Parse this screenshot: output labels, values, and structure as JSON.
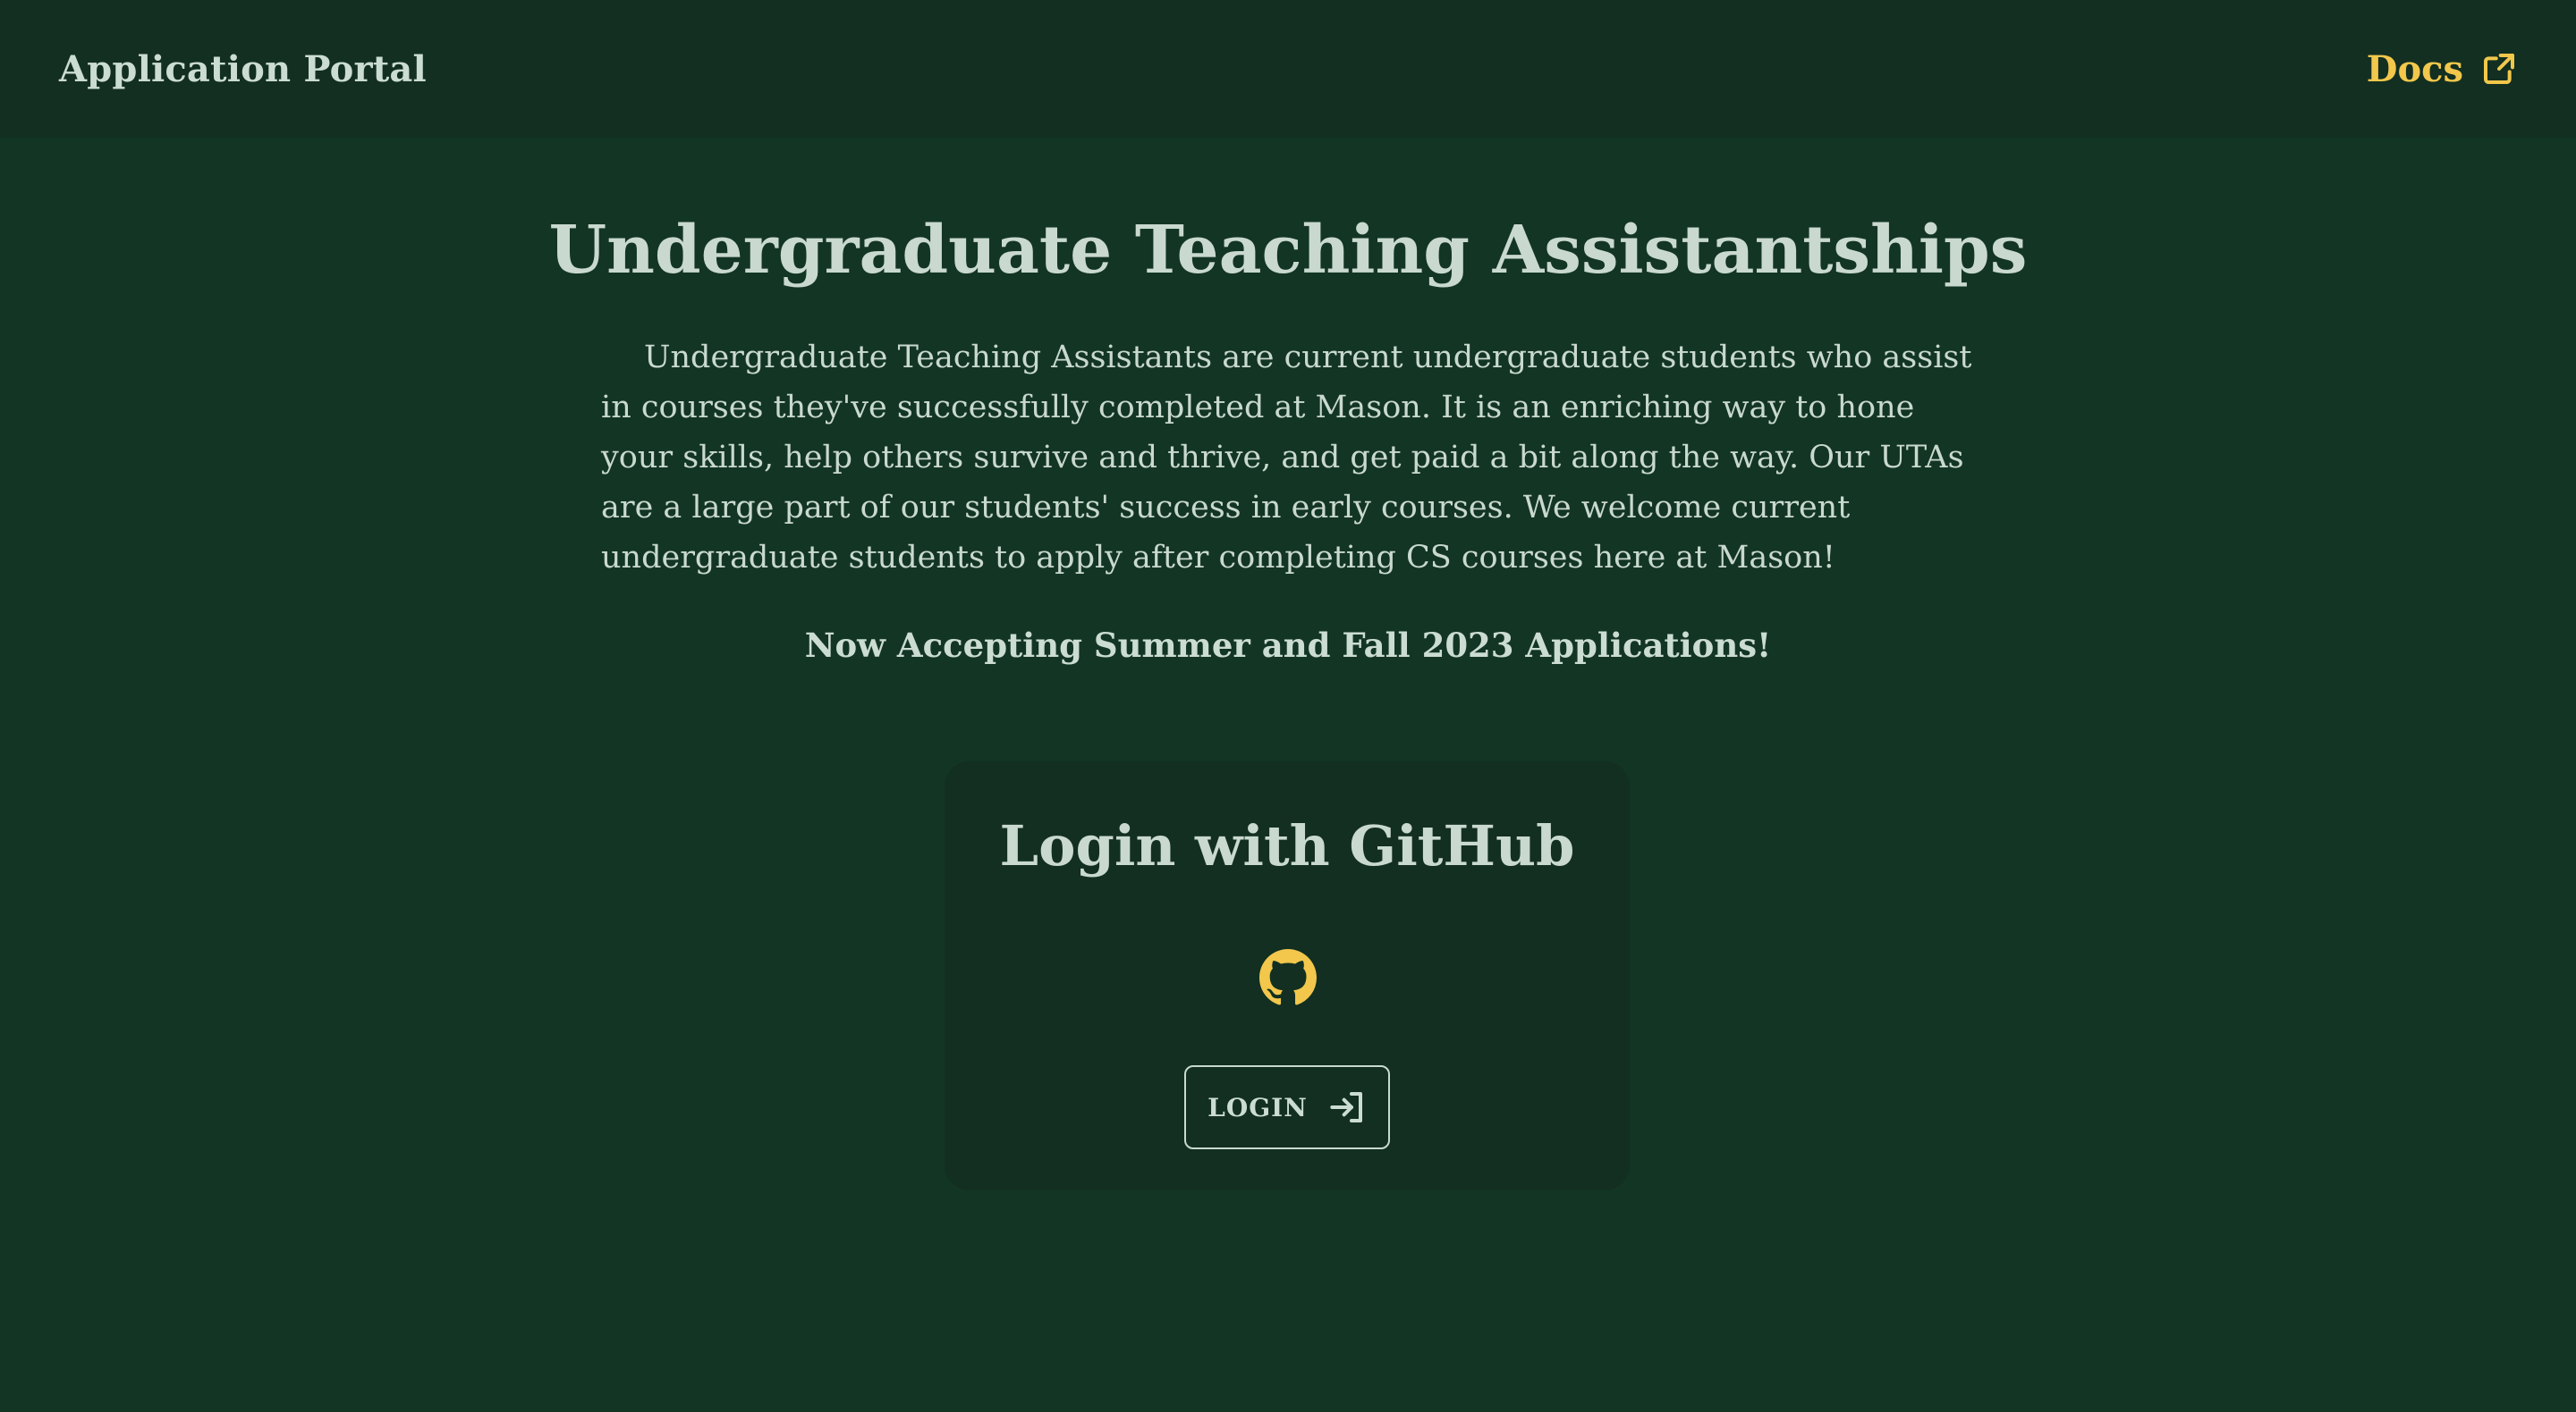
{
  "header": {
    "brand": "Application Portal",
    "docs_label": "Docs",
    "docs_icon": "external-link-icon"
  },
  "main": {
    "title": "Undergraduate Teaching Assistantships",
    "intro": "Undergraduate Teaching Assistants are current undergraduate students who assist in courses they've successfully completed at Mason. It is an enriching way to hone your skills, help others survive and thrive, and get paid a bit along the way. Our UTAs are a large part of our students' success in early courses. We welcome current undergraduate students to apply after completing CS courses here at Mason!",
    "announcement": "Now Accepting Summer and Fall 2023 Applications!"
  },
  "login_card": {
    "title": "Login with GitHub",
    "icon": "github-icon",
    "button_label": "LOGIN",
    "button_icon": "login-arrow-icon"
  },
  "colors": {
    "background": "#133524",
    "navbar": "#122f21",
    "accent": "#f2c74c",
    "text": "#c9d9cf"
  }
}
